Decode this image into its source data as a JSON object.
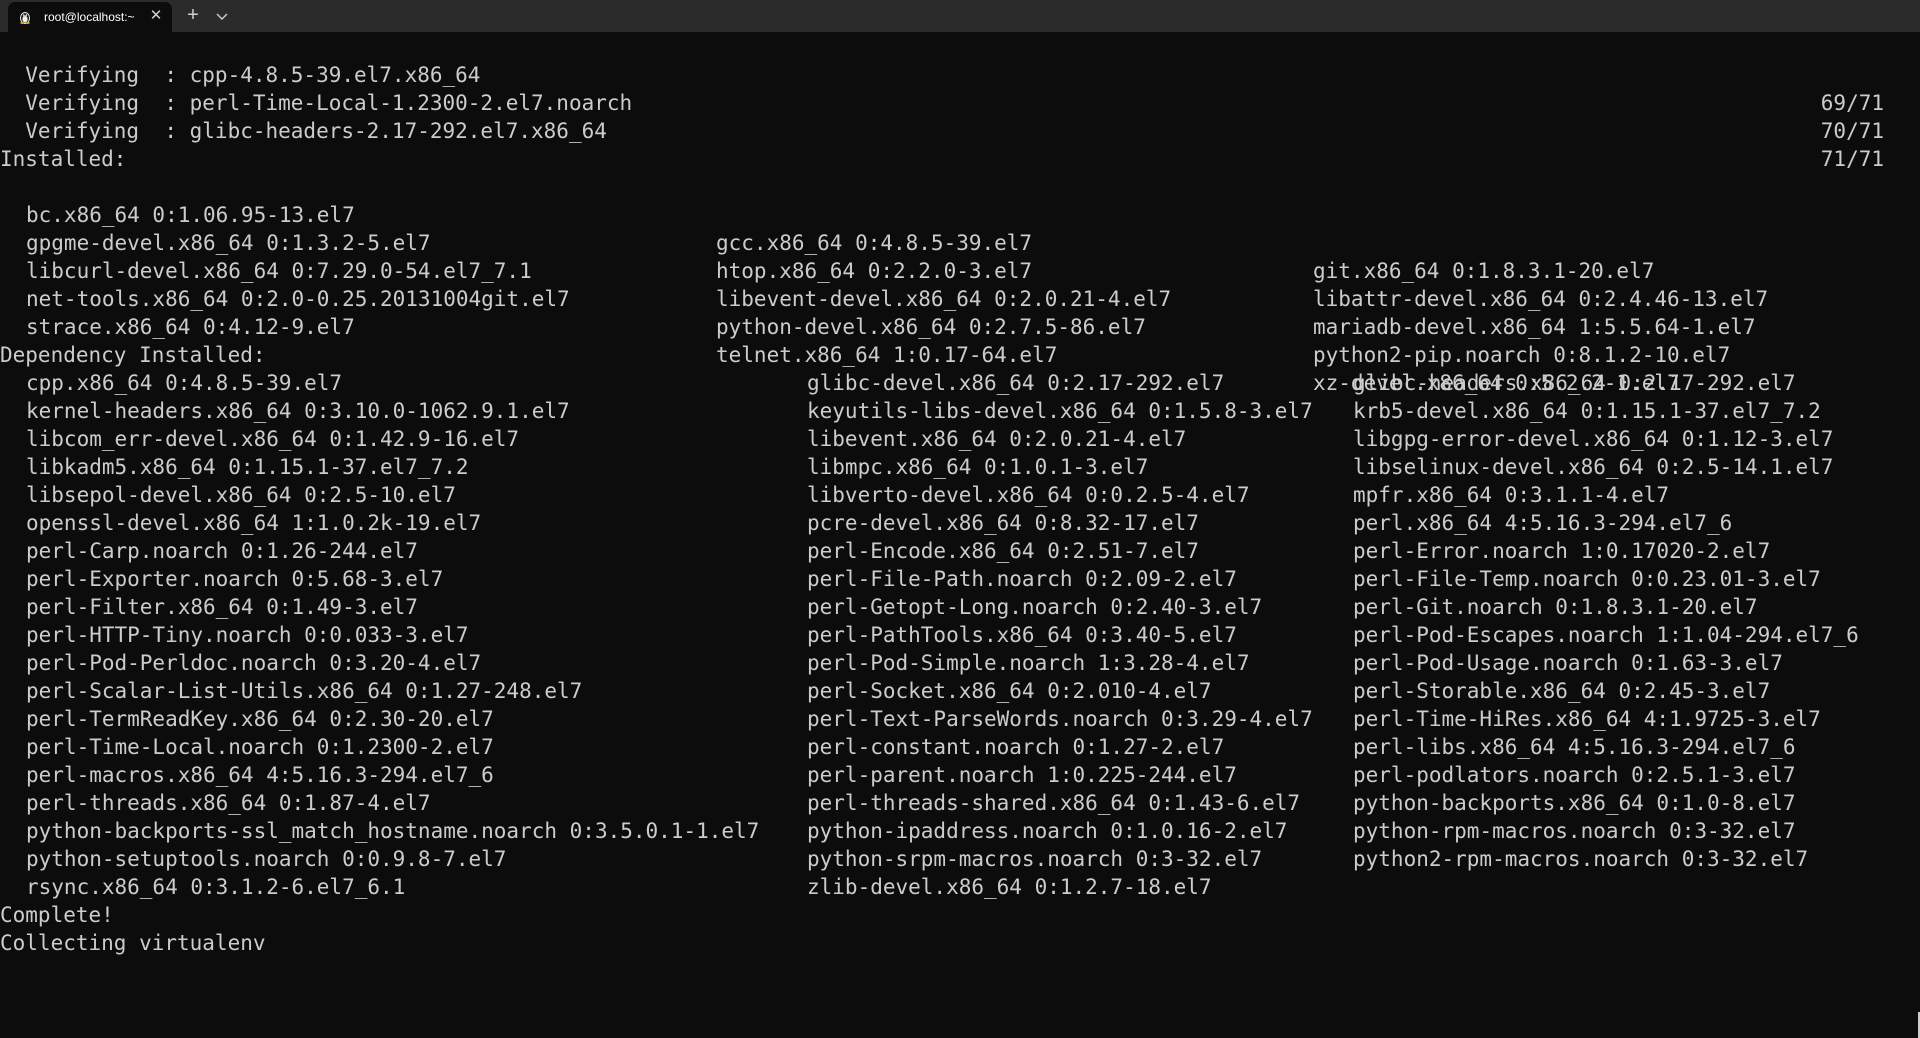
{
  "window": {
    "tab_title": "root@localhost:~",
    "tab_icon": "linux-tux-icon",
    "close_glyph": "✕",
    "new_tab_glyph": "+"
  },
  "terminal": {
    "verifying": [
      {
        "text": "  Verifying  : cpp-4.8.5-39.el7.x86_64",
        "progress": "69/71"
      },
      {
        "text": "  Verifying  : perl-Time-Local-1.2300-2.el7.noarch",
        "progress": "70/71"
      },
      {
        "text": "  Verifying  : glibc-headers-2.17-292.el7.x86_64",
        "progress": "71/71"
      }
    ],
    "installed_header": "Installed:",
    "installed": [
      [
        "bc.x86_64 0:1.06.95-13.el7",
        "gcc.x86_64 0:4.8.5-39.el7",
        "git.x86_64 0:1.8.3.1-20.el7"
      ],
      [
        "gpgme-devel.x86_64 0:1.3.2-5.el7",
        "htop.x86_64 0:2.2.0-3.el7",
        "libattr-devel.x86_64 0:2.4.46-13.el7"
      ],
      [
        "libcurl-devel.x86_64 0:7.29.0-54.el7_7.1",
        "libevent-devel.x86_64 0:2.0.21-4.el7",
        "mariadb-devel.x86_64 1:5.5.64-1.el7"
      ],
      [
        "net-tools.x86_64 0:2.0-0.25.20131004git.el7",
        "python-devel.x86_64 0:2.7.5-86.el7",
        "python2-pip.noarch 0:8.1.2-10.el7"
      ],
      [
        "strace.x86_64 0:4.12-9.el7",
        "telnet.x86_64 1:0.17-64.el7",
        "xz-devel.x86_64 0:5.2.2-1.el7"
      ]
    ],
    "dependency_header": "Dependency Installed:",
    "dependencies": [
      [
        "cpp.x86_64 0:4.8.5-39.el7",
        "glibc-devel.x86_64 0:2.17-292.el7",
        "glibc-headers.x86_64 0:2.17-292.el7"
      ],
      [
        "kernel-headers.x86_64 0:3.10.0-1062.9.1.el7",
        "keyutils-libs-devel.x86_64 0:1.5.8-3.el7",
        "krb5-devel.x86_64 0:1.15.1-37.el7_7.2"
      ],
      [
        "libcom_err-devel.x86_64 0:1.42.9-16.el7",
        "libevent.x86_64 0:2.0.21-4.el7",
        "libgpg-error-devel.x86_64 0:1.12-3.el7"
      ],
      [
        "libkadm5.x86_64 0:1.15.1-37.el7_7.2",
        "libmpc.x86_64 0:1.0.1-3.el7",
        "libselinux-devel.x86_64 0:2.5-14.1.el7"
      ],
      [
        "libsepol-devel.x86_64 0:2.5-10.el7",
        "libverto-devel.x86_64 0:0.2.5-4.el7",
        "mpfr.x86_64 0:3.1.1-4.el7"
      ],
      [
        "openssl-devel.x86_64 1:1.0.2k-19.el7",
        "pcre-devel.x86_64 0:8.32-17.el7",
        "perl.x86_64 4:5.16.3-294.el7_6"
      ],
      [
        "perl-Carp.noarch 0:1.26-244.el7",
        "perl-Encode.x86_64 0:2.51-7.el7",
        "perl-Error.noarch 1:0.17020-2.el7"
      ],
      [
        "perl-Exporter.noarch 0:5.68-3.el7",
        "perl-File-Path.noarch 0:2.09-2.el7",
        "perl-File-Temp.noarch 0:0.23.01-3.el7"
      ],
      [
        "perl-Filter.x86_64 0:1.49-3.el7",
        "perl-Getopt-Long.noarch 0:2.40-3.el7",
        "perl-Git.noarch 0:1.8.3.1-20.el7"
      ],
      [
        "perl-HTTP-Tiny.noarch 0:0.033-3.el7",
        "perl-PathTools.x86_64 0:3.40-5.el7",
        "perl-Pod-Escapes.noarch 1:1.04-294.el7_6"
      ],
      [
        "perl-Pod-Perldoc.noarch 0:3.20-4.el7",
        "perl-Pod-Simple.noarch 1:3.28-4.el7",
        "perl-Pod-Usage.noarch 0:1.63-3.el7"
      ],
      [
        "perl-Scalar-List-Utils.x86_64 0:1.27-248.el7",
        "perl-Socket.x86_64 0:2.010-4.el7",
        "perl-Storable.x86_64 0:2.45-3.el7"
      ],
      [
        "perl-TermReadKey.x86_64 0:2.30-20.el7",
        "perl-Text-ParseWords.noarch 0:3.29-4.el7",
        "perl-Time-HiRes.x86_64 4:1.9725-3.el7"
      ],
      [
        "perl-Time-Local.noarch 0:1.2300-2.el7",
        "perl-constant.noarch 0:1.27-2.el7",
        "perl-libs.x86_64 4:5.16.3-294.el7_6"
      ],
      [
        "perl-macros.x86_64 4:5.16.3-294.el7_6",
        "perl-parent.noarch 1:0.225-244.el7",
        "perl-podlators.noarch 0:2.5.1-3.el7"
      ],
      [
        "perl-threads.x86_64 0:1.87-4.el7",
        "perl-threads-shared.x86_64 0:1.43-6.el7",
        "python-backports.x86_64 0:1.0-8.el7"
      ],
      [
        "python-backports-ssl_match_hostname.noarch 0:3.5.0.1-1.el7",
        "python-ipaddress.noarch 0:1.0.16-2.el7",
        "python-rpm-macros.noarch 0:3-32.el7"
      ],
      [
        "python-setuptools.noarch 0:0.9.8-7.el7",
        "python-srpm-macros.noarch 0:3-32.el7",
        "python2-rpm-macros.noarch 0:3-32.el7"
      ],
      [
        "rsync.x86_64 0:3.1.2-6.el7_6.1",
        "zlib-devel.x86_64 0:1.2.7-18.el7",
        ""
      ]
    ],
    "complete": "Complete!",
    "collecting": "Collecting virtualenv"
  }
}
